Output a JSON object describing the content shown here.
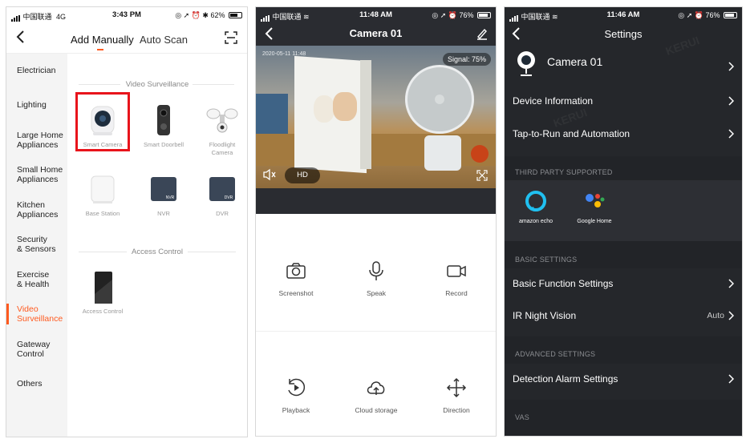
{
  "panel1": {
    "status": {
      "carrier": "中国联通",
      "network": "4G",
      "time": "3:43 PM",
      "battery": "62%"
    },
    "tabs": {
      "active": "Add Manually",
      "inactive": "Auto Scan"
    },
    "sidebar": [
      {
        "label": "Electrician"
      },
      {
        "label": "Lighting"
      },
      {
        "label": "Large Home\nAppliances"
      },
      {
        "label": "Small Home\nAppliances"
      },
      {
        "label": "Kitchen\nAppliances"
      },
      {
        "label": "Security\n& Sensors"
      },
      {
        "label": "Exercise\n& Health"
      },
      {
        "label": "Video\nSurveillance"
      },
      {
        "label": "Gateway\nControl"
      },
      {
        "label": "Others"
      }
    ],
    "sections": {
      "video": "Video Surveillance",
      "access": "Access Control"
    },
    "devices": {
      "smart_camera": "Smart Camera",
      "smart_doorbell": "Smart Doorbell",
      "floodlight": "Floodlight\nCamera",
      "base_station": "Base Station",
      "nvr": "NVR",
      "nvr_tag": "NVR",
      "dvr": "DVR",
      "dvr_tag": "DVR",
      "access_control": "Access Control"
    },
    "accent_color": "#ff5a1f",
    "highlight_color": "#e8141b"
  },
  "panel2": {
    "status": {
      "carrier": "中国联通",
      "time": "11:48 AM",
      "battery": "76%"
    },
    "title": "Camera 01",
    "video": {
      "timestamp": "2020-05-11 11:48",
      "signal": "Signal: 75%",
      "quality": "HD"
    },
    "actions": {
      "screenshot": "Screenshot",
      "speak": "Speak",
      "record": "Record",
      "playback": "Playback",
      "cloud": "Cloud storage",
      "direction": "Direction"
    }
  },
  "panel3": {
    "status": {
      "carrier": "中国联通",
      "time": "11:46 AM",
      "battery": "76%"
    },
    "title": "Settings",
    "device_name": "Camera 01",
    "rows": {
      "device_info": "Device Information",
      "tap_to_run": "Tap-to-Run and Automation",
      "basic_function": "Basic Function Settings",
      "ir_night": "IR Night Vision",
      "ir_night_value": "Auto",
      "detection_alarm": "Detection Alarm Settings"
    },
    "sections": {
      "third_party": "THIRD PARTY SUPPORTED",
      "basic": "BASIC SETTINGS",
      "advanced": "ADVANCED SETTINGS",
      "vas": "VAS"
    },
    "third_party": {
      "alexa": "amazon echo",
      "google": "Google Home"
    },
    "watermark": "KERUI"
  }
}
